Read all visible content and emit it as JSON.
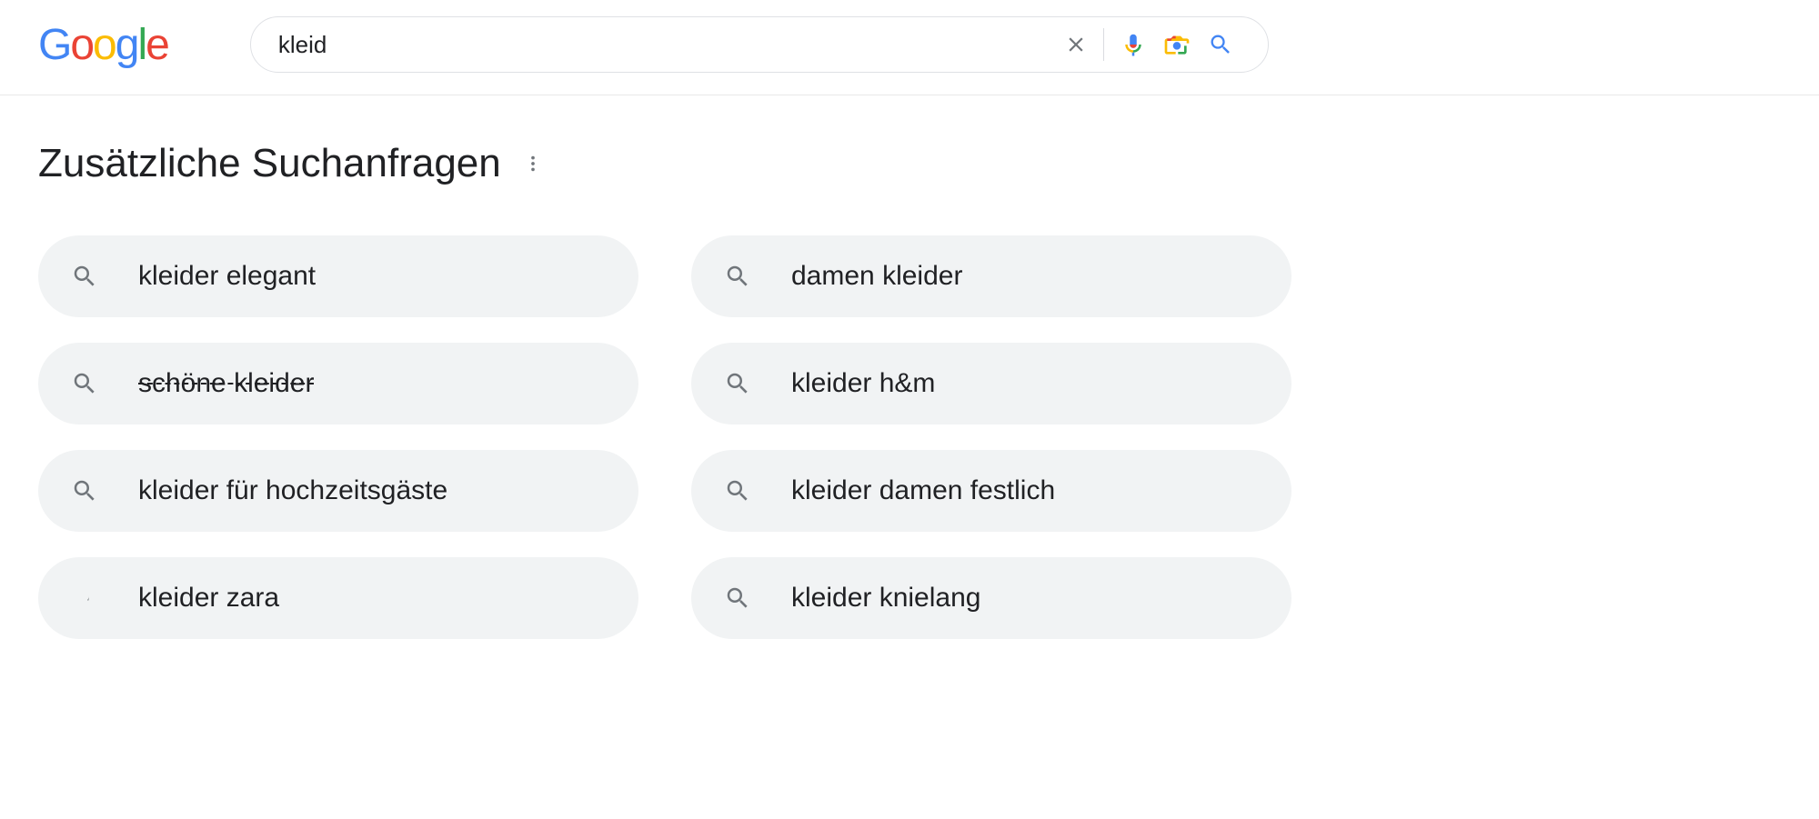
{
  "search": {
    "query": "kleid"
  },
  "section": {
    "title": "Zusätzliche Suchanfragen"
  },
  "related": {
    "col1": [
      {
        "label": "kleider elegant",
        "strike": false
      },
      {
        "label": "schöne kleider",
        "strike": true
      },
      {
        "label": "kleider für hochzeitsgäste",
        "strike": false
      },
      {
        "label": "kleider zara",
        "strike": false
      }
    ],
    "col2": [
      {
        "label": "damen kleider",
        "strike": false
      },
      {
        "label": "kleider h&m",
        "strike": false
      },
      {
        "label": "kleider damen festlich",
        "strike": false
      },
      {
        "label": "kleider knielang",
        "strike": false
      }
    ]
  }
}
